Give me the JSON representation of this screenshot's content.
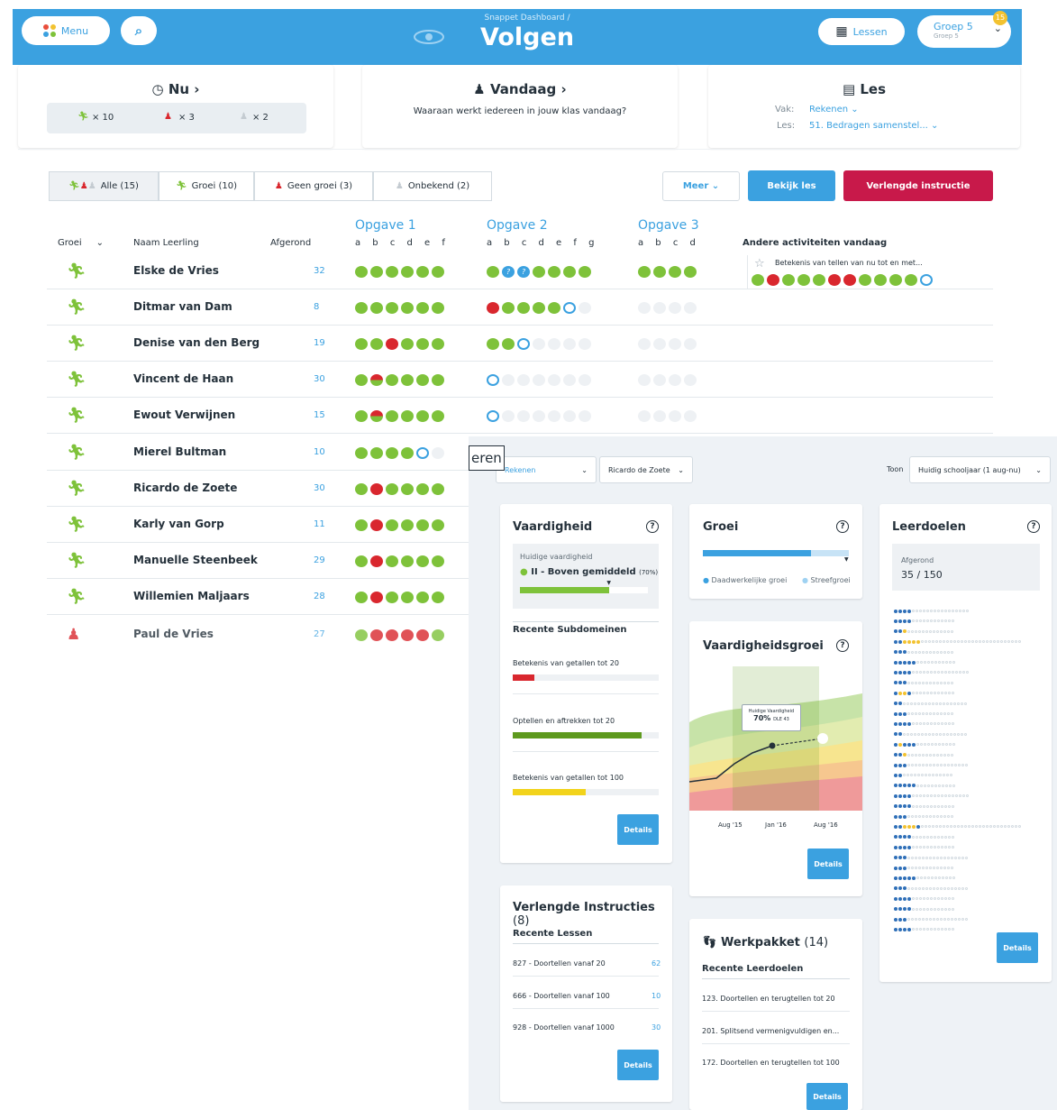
{
  "header": {
    "menu_label": "Menu",
    "subtitle": "Snappet Dashboard /",
    "title": "Volgen",
    "lessons_label": "Lessen",
    "group_label": "Groep 5",
    "group_sub": "Groep 5",
    "group_count": "15"
  },
  "now_card": {
    "title": "Nu",
    "green": "× 10",
    "red": "× 3",
    "grey": "× 2"
  },
  "today_card": {
    "title": "Vandaag",
    "text": "Waaraan werkt iedereen in jouw klas vandaag?"
  },
  "les_card": {
    "title": "Les",
    "vak_label": "Vak:",
    "vak_value": "Rekenen",
    "les_label": "Les:",
    "les_value": "51. Bedragen samenstel..."
  },
  "filters": {
    "all": "Alle (15)",
    "growth": "Groei (10)",
    "no_growth": "Geen groei (3)",
    "unknown": "Onbekend (2)"
  },
  "buttons": {
    "more": "Meer",
    "view_lesson": "Bekijk les",
    "extended": "Verlengde instructie"
  },
  "table": {
    "col_growth": "Groei",
    "col_name": "Naam Leerling",
    "col_done": "Afgerond",
    "opgave1": "Opgave 1",
    "letters1": "a b c d e f",
    "opgave2": "Opgave 2",
    "letters2": "a b c d e f g",
    "opgave3": "Opgave 3",
    "letters3": "a b c d",
    "col_other": "Andere activiteiten vandaag",
    "other_activity": "Betekenis van tellen van nu tot en met...",
    "rows": [
      {
        "name": "Elske de Vries",
        "done": "32",
        "status": "green"
      },
      {
        "name": "Ditmar van Dam",
        "done": "8",
        "status": "green"
      },
      {
        "name": "Denise van den Berg",
        "done": "19",
        "status": "green"
      },
      {
        "name": "Vincent de Haan",
        "done": "30",
        "status": "green"
      },
      {
        "name": "Ewout Verwijnen",
        "done": "15",
        "status": "green"
      },
      {
        "name": "Mierel Bultman",
        "done": "10",
        "status": "green"
      },
      {
        "name": "Ricardo de Zoete",
        "done": "30",
        "status": "green"
      },
      {
        "name": "Karly van Gorp",
        "done": "11",
        "status": "green"
      },
      {
        "name": "Manuelle Steenbeek",
        "done": "29",
        "status": "green"
      },
      {
        "name": "Willemien Maljaars",
        "done": "28",
        "status": "green"
      },
      {
        "name": "Paul de Vries",
        "done": "27",
        "status": "red"
      }
    ]
  },
  "tooltip_fragment": "eren",
  "overlay": {
    "subject_select": "Rekenen",
    "student_select": "Ricardo de Zoete",
    "show_label": "Toon",
    "period_select": "Huidig schooljaar (1 aug-nu)",
    "skill": {
      "title": "Vaardigheid",
      "current_label": "Huidige vaardigheid",
      "level": "II - Boven gemiddeld",
      "level_pct": "(70%)",
      "level_fraction": 0.7,
      "recent_title": "Recente Subdomeinen",
      "subdomains": [
        {
          "label": "Betekenis van getallen tot 20",
          "fraction": 0.15,
          "color": "#d9272e"
        },
        {
          "label": "Optellen en aftrekken tot 20",
          "fraction": 0.88,
          "color": "#5e9a1e"
        },
        {
          "label": "Betekenis van getallen tot 100",
          "fraction": 0.5,
          "color": "#f2d31b"
        }
      ],
      "details": "Details"
    },
    "growth": {
      "title": "Groei",
      "actual_fraction": 0.74,
      "legend_actual": "Daadwerkelijke groei",
      "legend_target": "Streefgroei"
    },
    "skill_growth": {
      "title": "Vaardigheidsgroei",
      "tooltip_title": "Huidige Vaardigheid",
      "tooltip_value": "70%",
      "tooltip_sub": "DLE 43",
      "x_labels": [
        "Aug '15",
        "Jan '16",
        "Aug '16"
      ],
      "details": "Details"
    },
    "goals": {
      "title": "Leerdoelen",
      "done_label": "Afgerond",
      "done_value": "35 / 150",
      "details": "Details"
    },
    "extended": {
      "title": "Verlengde Instructies",
      "count": "(8)",
      "recent_title": "Recente Lessen",
      "items": [
        {
          "label": "827 - Doortellen vanaf 20",
          "value": "62"
        },
        {
          "label": "666 - Doortellen vanaf 100",
          "value": "10"
        },
        {
          "label": "928 - Doortellen vanaf 1000",
          "value": "30"
        }
      ],
      "details": "Details"
    },
    "package": {
      "title": "Werkpakket",
      "count": "(14)",
      "recent_title": "Recente Leerdoelen",
      "items": [
        {
          "label": "123. Doortellen en terugtellen tot 20"
        },
        {
          "label": "201. Splitsend vermenigvuldigen en..."
        },
        {
          "label": "172. Doortellen en terugtellen tot 100"
        }
      ],
      "details": "Details"
    }
  },
  "colors": {
    "brand_blue": "#3ba1e0",
    "accent_red": "#c8194a",
    "green": "#7ec23a",
    "red": "#d9272e"
  }
}
